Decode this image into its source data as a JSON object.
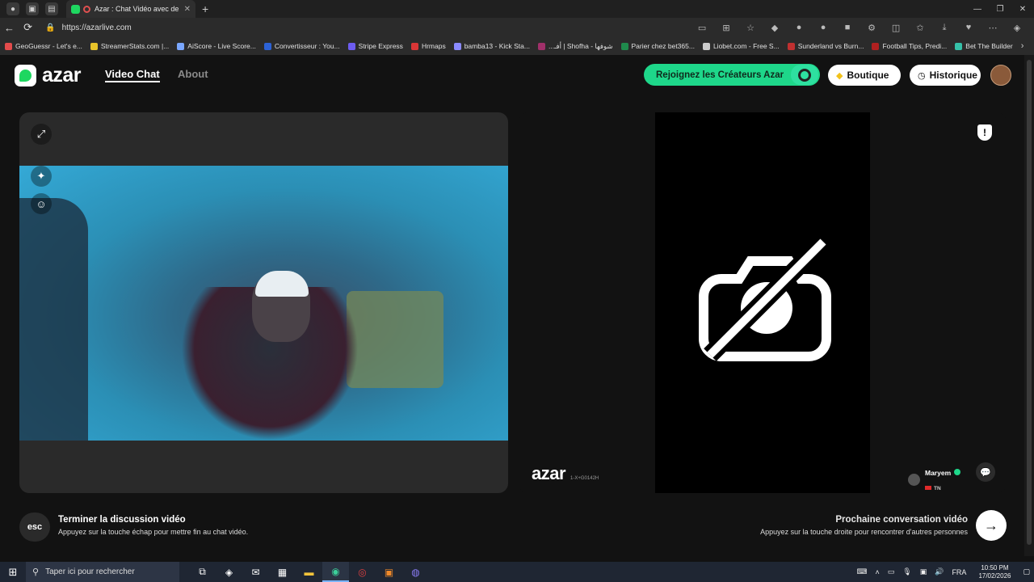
{
  "browser": {
    "tab_title": "Azar : Chat Vidéo avec de n",
    "url": "https://azarlive.com",
    "bookmarks": [
      "GeoGuessr - Let's e...",
      "StreamerStats.com |...",
      "AiScore - Live Score...",
      "Convertisseur : You...",
      "Stripe Express",
      "Hrmaps",
      "bamba13 - Kick Sta...",
      "...أفـ | Shofha - شوفها",
      "Parier chez bet365...",
      "Liobet.com - Free S...",
      "Sunderland vs Burn...",
      "Football Tips, Predi...",
      "Bet The Builder"
    ]
  },
  "header": {
    "logo_text": "azar",
    "nav": {
      "video_chat": "Video Chat",
      "about": "About"
    },
    "creators_button": "Rejoignez les Créateurs Azar",
    "shop_button": "Boutique",
    "history_button": "Historique"
  },
  "remote": {
    "watermark": "azar",
    "watermark_code": "1-X+G0142H",
    "peer_name": "Maryem",
    "peer_country": "TN"
  },
  "footer": {
    "esc_key": "esc",
    "end_title": "Terminer la discussion vidéo",
    "end_subtitle": "Appuyez sur la touche échap pour mettre fin au chat vidéo.",
    "next_title": "Prochaine conversation vidéo",
    "next_subtitle": "Appuyez sur la touche droite pour rencontrer d'autres personnes"
  },
  "taskbar": {
    "search_placeholder": "Taper ici pour rechercher",
    "language": "FRA",
    "time": "10:50 PM",
    "date": "17/02/2026"
  },
  "colors": {
    "accent_green": "#1ed78a",
    "page_bg": "#121212",
    "panel_bg": "#2a2a2a"
  }
}
